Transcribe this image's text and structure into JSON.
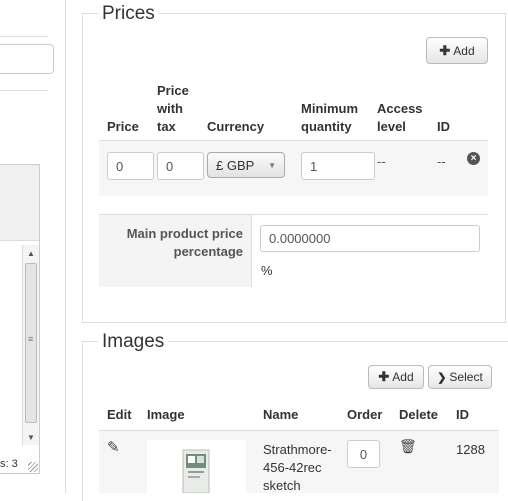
{
  "left_pane": {
    "status": "s: 3"
  },
  "prices": {
    "legend": "Prices",
    "add_button": "Add",
    "columns": {
      "price": "Price",
      "price_with_tax_line1": "Price",
      "price_with_tax_line2": "with",
      "price_with_tax_line3": "tax",
      "currency": "Currency",
      "min_qty_line1": "Minimum",
      "min_qty_line2": "quantity",
      "access_line1": "Access",
      "access_line2": "level",
      "id": "ID"
    },
    "row": {
      "price": "0",
      "price_with_tax": "0",
      "currency": "£ GBP",
      "min_qty": "1",
      "access_level": "--",
      "id": "--"
    },
    "main_price": {
      "label_line1": "Main product price",
      "label_line2": "percentage",
      "value": "0.0000000",
      "unit": "%"
    }
  },
  "images": {
    "legend": "Images",
    "add_button": "Add",
    "select_button": "Select",
    "columns": {
      "edit": "Edit",
      "image": "Image",
      "name": "Name",
      "order": "Order",
      "delete": "Delete",
      "id": "ID"
    },
    "row": {
      "name_line1": "Strathmore-",
      "name_line2": "456-42rec",
      "name_line3": "sketch",
      "order": "0",
      "id": "1288"
    }
  }
}
